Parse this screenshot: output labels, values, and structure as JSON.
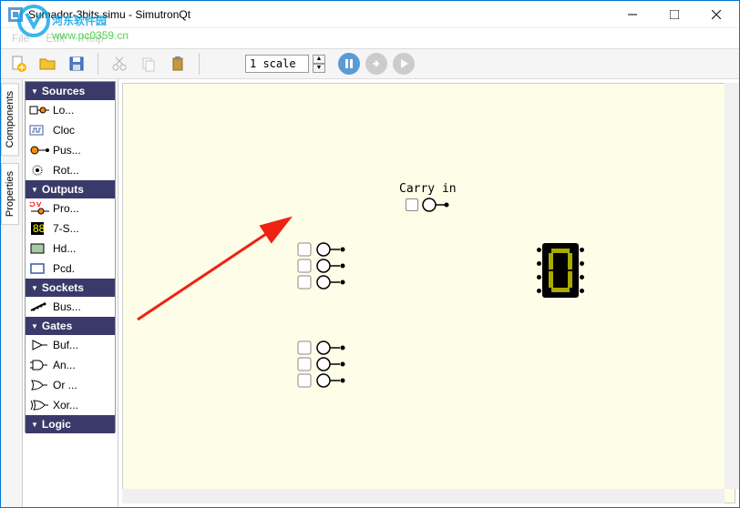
{
  "window": {
    "title": "Sumador-3bits.simu - SimutronQt"
  },
  "menu": {
    "file": "File",
    "edit": "Edit",
    "help": "Help"
  },
  "toolbar": {
    "scale_value": "1 scale"
  },
  "tabs": {
    "components": "Components",
    "properties": "Properties"
  },
  "sidebar": {
    "categories": [
      {
        "name": "Sources",
        "items": [
          {
            "label": "Lo...",
            "icon": "logic-input"
          },
          {
            "label": "Cloc",
            "icon": "clock"
          },
          {
            "label": "Pus...",
            "icon": "push"
          },
          {
            "label": "Rot...",
            "icon": "rotary"
          }
        ]
      },
      {
        "name": "Outputs",
        "items": [
          {
            "label": "Pro...",
            "icon": "probe"
          },
          {
            "label": "7-S...",
            "icon": "sevenseg"
          },
          {
            "label": "Hd...",
            "icon": "hd"
          },
          {
            "label": "Pcd.",
            "icon": "pcd"
          }
        ]
      },
      {
        "name": "Sockets",
        "items": [
          {
            "label": "Bus...",
            "icon": "bus"
          }
        ]
      },
      {
        "name": "Gates",
        "items": [
          {
            "label": "Buf...",
            "icon": "buffer"
          },
          {
            "label": "An...",
            "icon": "and"
          },
          {
            "label": "Or ...",
            "icon": "or"
          },
          {
            "label": "Xor...",
            "icon": "xor"
          }
        ]
      },
      {
        "name": "Logic",
        "items": []
      }
    ]
  },
  "canvas": {
    "label_carry": "Carry in"
  },
  "watermark": {
    "text1": "河东软件园",
    "url": "www.pc0359.cn"
  }
}
